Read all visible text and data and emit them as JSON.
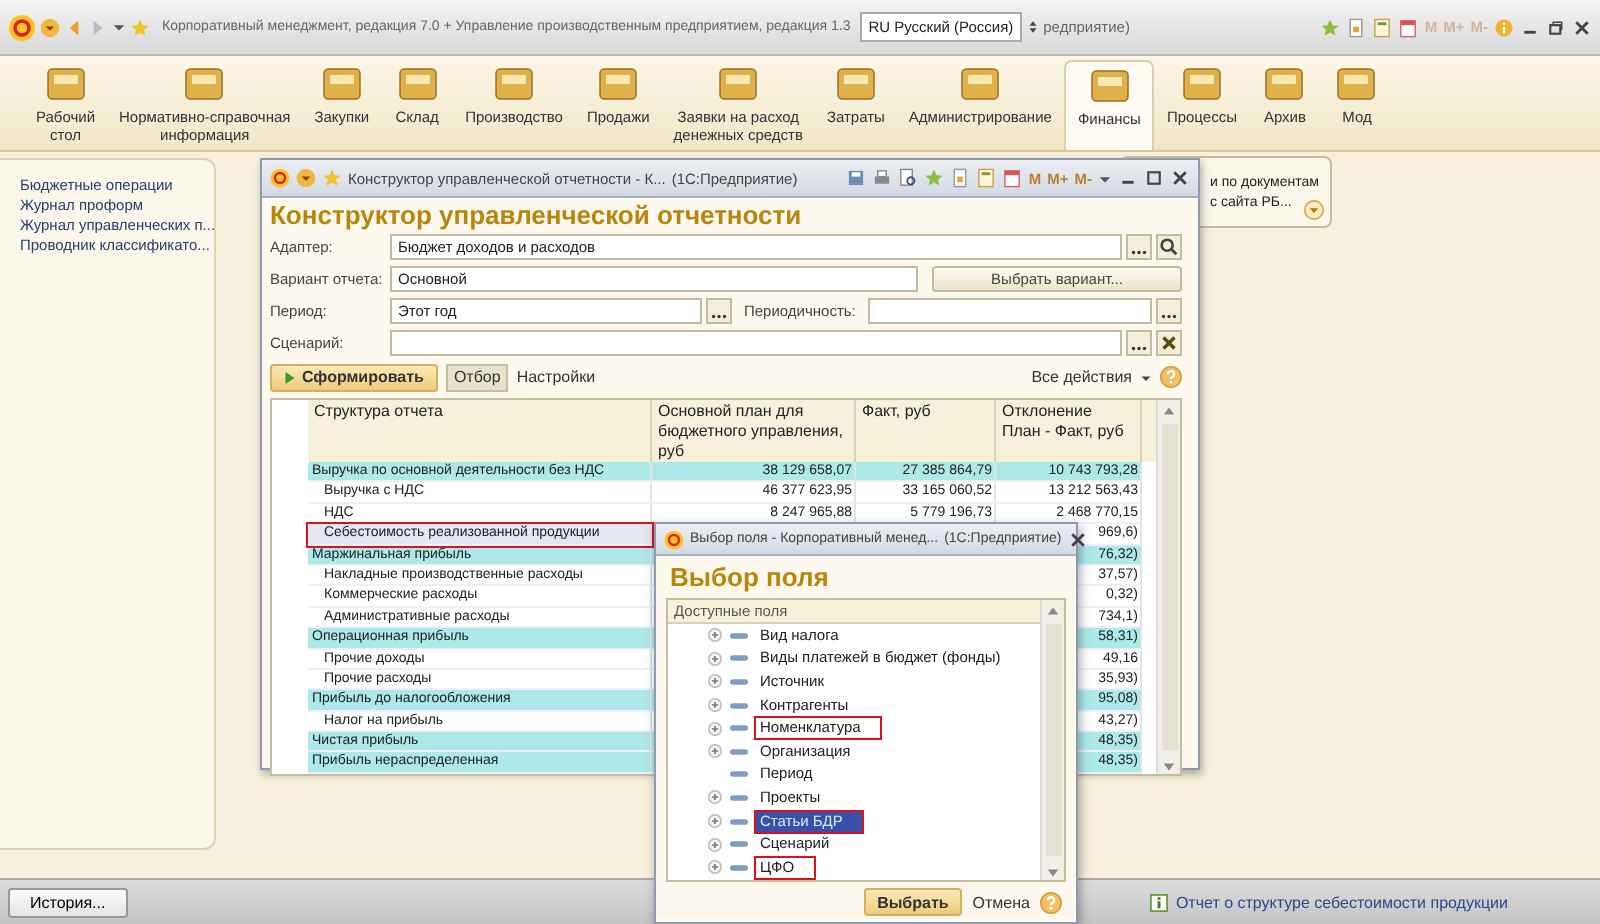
{
  "topbar": {
    "title": "Корпоративный менеджмент, редакция 7.0 + Управление производственным предприятием, редакция 1.3",
    "language": "RU Русский (Россия)",
    "title_tail": "редприятие)",
    "memory_buttons": [
      "M",
      "M+",
      "M-"
    ]
  },
  "sections": [
    {
      "label": "Рабочий\nстол",
      "selected": false
    },
    {
      "label": "Нормативно-справочная\nинформация",
      "selected": false
    },
    {
      "label": "Закупки",
      "selected": false
    },
    {
      "label": "Склад",
      "selected": false
    },
    {
      "label": "Производство",
      "selected": false
    },
    {
      "label": "Продажи",
      "selected": false
    },
    {
      "label": "Заявки на расход\nденежных средств",
      "selected": false
    },
    {
      "label": "Затраты",
      "selected": false
    },
    {
      "label": "Администрирование",
      "selected": false
    },
    {
      "label": "Финансы",
      "selected": true
    },
    {
      "label": "Процессы",
      "selected": false
    },
    {
      "label": "Архив",
      "selected": false
    },
    {
      "label": "Мод",
      "selected": false
    }
  ],
  "sidebar": {
    "items": [
      "Бюджетные операции",
      "Журнал проформ",
      "Журнал управленческих п...",
      "Проводник классификато..."
    ]
  },
  "background_window": {
    "lines": [
      "и по документам",
      "с сайта РБ..."
    ]
  },
  "report_window": {
    "title": "Конструктор управленческой отчетности - К...",
    "app": "(1С:Предприятие)",
    "memory_buttons": [
      "M",
      "M+",
      "M-"
    ],
    "heading": "Конструктор управленческой отчетности",
    "adapter": {
      "label": "Адаптер:",
      "value": "Бюджет доходов и расходов"
    },
    "variant": {
      "label": "Вариант отчета:",
      "value": "Основной",
      "button": "Выбрать вариант..."
    },
    "period": {
      "label": "Период:",
      "value": "Этот год",
      "periodicity_label": "Периодичность:"
    },
    "scenario": {
      "label": "Сценарий:"
    },
    "toolbar": {
      "generate": "Сформировать",
      "filter": {
        "label": "Отбор",
        "selected": true
      },
      "settings": "Настройки",
      "all_actions": "Все действия"
    },
    "table": {
      "columns": [
        "Структура отчета",
        "Основной план для бюджетного управления, руб",
        "Факт, руб",
        "Отклонение План - Факт, руб"
      ],
      "rows": [
        {
          "kind": "group",
          "name": "Выручка по основной деятельности без НДС",
          "plan": "38 129 658,07",
          "fact": "27 385 864,79",
          "deviation": "10 743 793,28",
          "highlighted": false
        },
        {
          "kind": "item",
          "name": "Выручка с НДС",
          "plan": "46 377 623,95",
          "fact": "33 165 060,52",
          "deviation": "13 212 563,43",
          "highlighted": false
        },
        {
          "kind": "item",
          "name": "НДС",
          "plan": "8 247 965,88",
          "fact": "5 779 196,73",
          "deviation": "2 468 770,15",
          "highlighted": false
        },
        {
          "kind": "item",
          "name": "Себестоимость реализованной продукции",
          "deviation": "969,6)",
          "highlighted": true
        },
        {
          "kind": "group",
          "name": "Маржинальная прибыль",
          "deviation": "76,32)",
          "highlighted": false
        },
        {
          "kind": "item",
          "name": "Накладные производственные расходы",
          "deviation": "37,57)",
          "highlighted": false
        },
        {
          "kind": "item",
          "name": "Коммерческие расходы",
          "deviation": "0,32)",
          "highlighted": false
        },
        {
          "kind": "item",
          "name": "Административные расходы",
          "deviation": "734,1)",
          "highlighted": false
        },
        {
          "kind": "group",
          "name": "Операционная прибыль",
          "deviation": "58,31)",
          "highlighted": false
        },
        {
          "kind": "item",
          "name": "Прочие доходы",
          "deviation": "49,16",
          "highlighted": false
        },
        {
          "kind": "item",
          "name": "Прочие расходы",
          "deviation": "35,93)",
          "highlighted": false
        },
        {
          "kind": "group",
          "name": "Прибыль до налогообложения",
          "deviation": "95,08)",
          "highlighted": false
        },
        {
          "kind": "item",
          "name": "Налог на прибыль",
          "deviation": "43,27)",
          "highlighted": false
        },
        {
          "kind": "group",
          "name": "Чистая прибыль",
          "deviation": "48,35)",
          "highlighted": false
        },
        {
          "kind": "group",
          "name": "Прибыль нераспределенная",
          "deviation": "48,35)",
          "highlighted": false
        }
      ]
    }
  },
  "popup": {
    "title": "Выбор поля - Корпоративный менед...",
    "app": "(1С:Предприятие)",
    "heading": "Выбор поля",
    "panel_title": "Доступные поля",
    "items": [
      {
        "label": "Вид налога",
        "expandable": true,
        "selected": false,
        "highlighted": false
      },
      {
        "label": "Виды платежей в бюджет (фонды)",
        "expandable": true,
        "selected": false,
        "highlighted": false
      },
      {
        "label": "Источник",
        "expandable": true,
        "selected": false,
        "highlighted": false
      },
      {
        "label": "Контрагенты",
        "expandable": true,
        "selected": false,
        "highlighted": false
      },
      {
        "label": "Номенклатура",
        "expandable": true,
        "selected": false,
        "highlighted": true
      },
      {
        "label": "Организация",
        "expandable": true,
        "selected": false,
        "highlighted": false
      },
      {
        "label": "Период",
        "expandable": false,
        "selected": false,
        "highlighted": false
      },
      {
        "label": "Проекты",
        "expandable": true,
        "selected": false,
        "highlighted": false
      },
      {
        "label": "Статьи БДР",
        "expandable": true,
        "selected": true,
        "highlighted": true
      },
      {
        "label": "Сценарий",
        "expandable": true,
        "selected": false,
        "highlighted": false
      },
      {
        "label": "ЦФО",
        "expandable": true,
        "selected": false,
        "highlighted": true
      }
    ],
    "ok": "Выбрать",
    "cancel": "Отмена"
  },
  "bottom": {
    "history": "История...",
    "link": "Отчет о структуре себестоимости продукции"
  }
}
